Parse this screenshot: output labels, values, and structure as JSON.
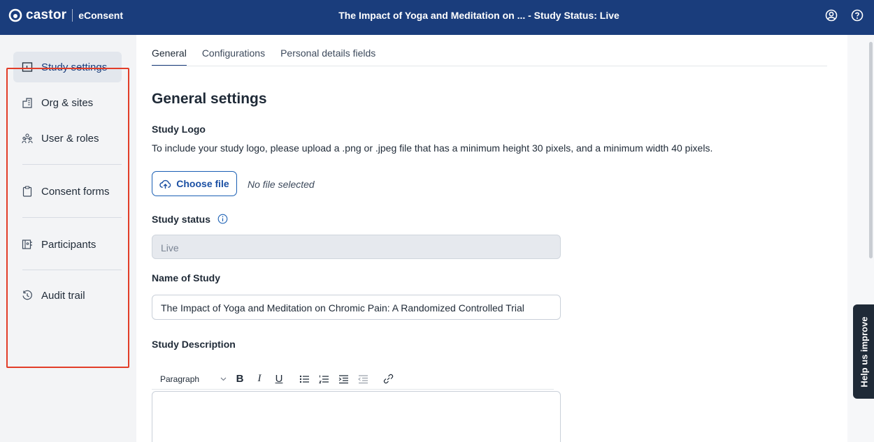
{
  "header": {
    "brand": "castor",
    "product": "eConsent",
    "title": "The Impact of Yoga and Meditation on ... - Study Status: Live",
    "icons": [
      "account-icon",
      "help-icon"
    ]
  },
  "sidebar": {
    "items": [
      {
        "label": "Study settings",
        "icon": "study-settings-icon",
        "active": true
      },
      {
        "label": "Org & sites",
        "icon": "building-icon"
      },
      {
        "label": "User & roles",
        "icon": "users-icon"
      },
      {
        "label": "Consent forms",
        "icon": "clipboard-icon"
      },
      {
        "label": "Participants",
        "icon": "participants-icon"
      },
      {
        "label": "Audit trail",
        "icon": "history-icon"
      }
    ]
  },
  "tabs": [
    {
      "label": "General",
      "active": true
    },
    {
      "label": "Configurations"
    },
    {
      "label": "Personal details fields"
    }
  ],
  "general": {
    "heading": "General settings",
    "logo_label": "Study Logo",
    "logo_help": "To include your study logo, please upload a .png or .jpeg file that has a minimum height 30 pixels, and a minimum width 40 pixels.",
    "choose_file": "Choose file",
    "no_file": "No file selected",
    "status_label": "Study status",
    "status_value": "Live",
    "name_label": "Name of Study",
    "name_value": "The Impact of Yoga and Meditation on Chromic Pain: A Randomized Controlled Trial",
    "description_label": "Study Description"
  },
  "editor_toolbar": {
    "paragraph": "Paragraph",
    "bold": "B",
    "italic": "I",
    "underline": "U"
  },
  "feedback": {
    "label": "Help us improve"
  },
  "colors": {
    "header": "#1a3d7c",
    "accent": "#1a5fb4",
    "highlight": "#e23d28"
  }
}
